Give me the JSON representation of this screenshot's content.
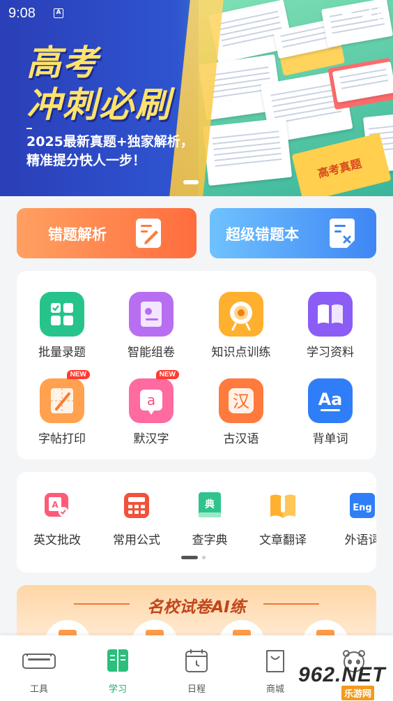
{
  "status_bar": {
    "time": "9:08",
    "notification_glyph": "A"
  },
  "banner": {
    "headline_line1": "高考",
    "headline_line2": "冲刺必刷",
    "subline1": "2025最新真题+独家解析，",
    "subline2": "精准提分快人一步！",
    "book_label": "高考真题"
  },
  "features": {
    "left_label": "错题解析",
    "right_label": "超级错题本"
  },
  "grid": {
    "items": [
      {
        "label": "批量录题",
        "icon": "grid-icon",
        "color": "#26c48a",
        "badge": ""
      },
      {
        "label": "智能组卷",
        "icon": "paper-icon",
        "color": "#b86ef0",
        "badge": ""
      },
      {
        "label": "知识点训练",
        "icon": "target-icon",
        "color": "#ffb02e",
        "badge": ""
      },
      {
        "label": "学习资料",
        "icon": "book-icon",
        "color": "#8b5cf6",
        "badge": ""
      },
      {
        "label": "字帖打印",
        "icon": "copybook-icon",
        "color": "#ffa14f",
        "badge": "NEW"
      },
      {
        "label": "默汉字",
        "icon": "dictation-icon",
        "color": "#ff6aa0",
        "badge": "NEW"
      },
      {
        "label": "古汉语",
        "icon": "classical-chinese-icon",
        "color": "#ff7a3d",
        "badge": ""
      },
      {
        "label": "背单词",
        "icon": "vocabulary-icon",
        "color": "#2f7ef7",
        "badge": ""
      }
    ],
    "glyph_dictation": "a",
    "glyph_classical": "汉",
    "glyph_vocab": "Aa"
  },
  "tools": {
    "items": [
      {
        "label": "英文批改",
        "icon": "english-correct-icon",
        "color": "#ff4f6e"
      },
      {
        "label": "常用公式",
        "icon": "formula-icon",
        "color": "#f2513a"
      },
      {
        "label": "查字典",
        "icon": "dictionary-icon",
        "color": "#2ec48c"
      },
      {
        "label": "文章翻译",
        "icon": "translate-icon",
        "color": "#ffb02e"
      },
      {
        "label": "外语词",
        "icon": "foreign-words-icon",
        "color": "#2f7ef7"
      }
    ],
    "glyph_dictionary": "典",
    "glyph_eng": "Eng",
    "pager_active": 0,
    "pager_count": 2
  },
  "exam": {
    "title": "名校试卷AI练"
  },
  "bottom_nav": {
    "items": [
      {
        "label": "工具",
        "icon": "toolbox-icon"
      },
      {
        "label": "学习",
        "icon": "study-book-icon",
        "active": true
      },
      {
        "label": "日程",
        "icon": "calendar-icon"
      },
      {
        "label": "商城",
        "icon": "shopping-bag-icon"
      },
      {
        "label": "",
        "icon": "profile-panda-icon"
      }
    ]
  },
  "watermark": {
    "brand": "962.NET",
    "sub": "乐游网"
  }
}
